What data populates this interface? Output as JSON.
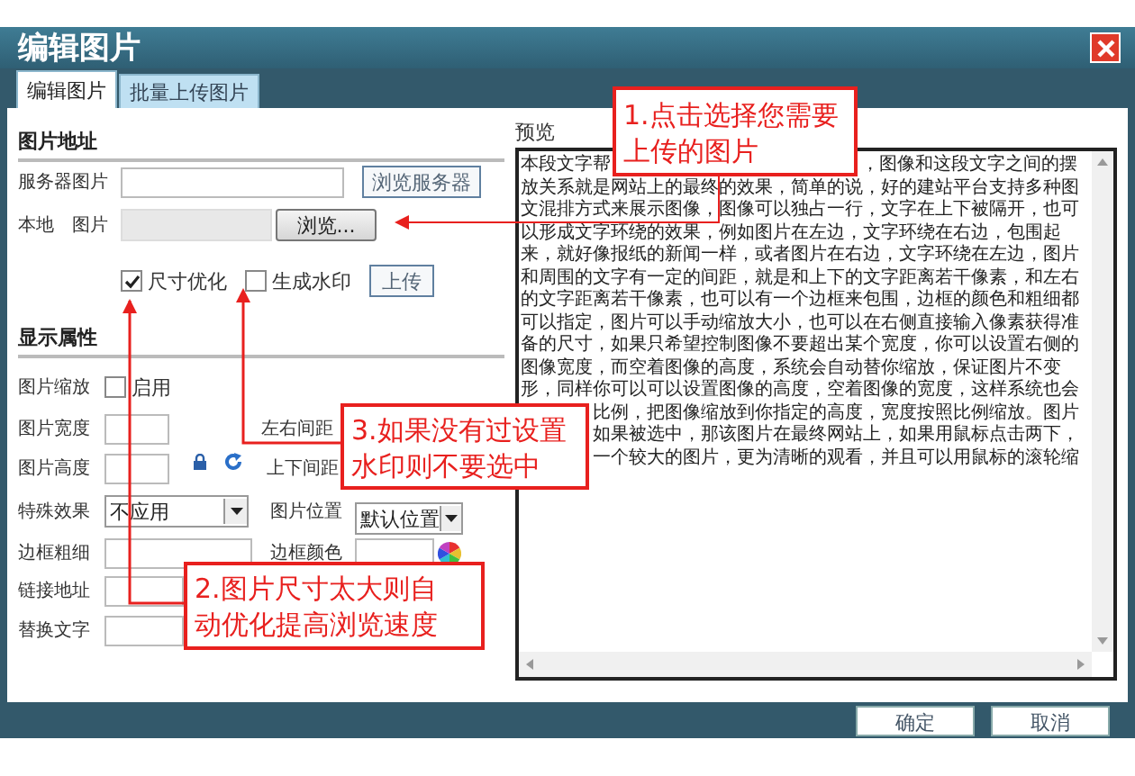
{
  "window": {
    "title": "编辑图片"
  },
  "tabs": [
    {
      "label": "编辑图片",
      "selected": true
    },
    {
      "label": "批量上传图片",
      "selected": false
    }
  ],
  "image_source": {
    "heading": "图片地址",
    "server_label": "服务器图片",
    "browse_server_button": "浏览服务器",
    "local_label": "本地　图片",
    "browse_button": "浏览...",
    "options": [
      {
        "label": "尺寸优化",
        "checked": true
      },
      {
        "label": "生成水印",
        "checked": false
      }
    ],
    "upload_button": "上传"
  },
  "display": {
    "heading": "显示属性",
    "scale_label": "图片缩放",
    "scale_option": {
      "label": "启用",
      "checked": false
    },
    "width_label": "图片宽度",
    "hspace_label": "左右间距",
    "height_label": "图片高度",
    "vspace_label": "上下间距",
    "effect_label": "特殊效果",
    "effect_value": "不应用",
    "position_label": "图片位置",
    "position_value": "默认位置",
    "border_width_label": "边框粗细",
    "border_color_label": "边框颜色",
    "link_label": "链接地址",
    "alt_label": "替换文字"
  },
  "preview": {
    "label": "预览",
    "lines": [
      {
        "parts": [
          "本段文字帮",
          "，图像和这段文字之间的摆"
        ],
        "lead_hidden": false
      },
      {
        "parts": [
          "放关系就是网站上的最终的效果，简单的说，好的建站平台支持多种图"
        ],
        "lead_hidden": false
      },
      {
        "parts": [
          "文混排方式来展示图像，图像可以独占一行，文字在上下被隔开，也可"
        ],
        "lead_hidden": false
      },
      {
        "parts": [
          "以形成文字环绕的效果，例如图片在左边，文字环绕在右边，包围起"
        ],
        "lead_hidden": false
      },
      {
        "parts": [
          "来，就好像报纸的新闻一样，或者图片在右边，文字环绕在左边，图片"
        ],
        "lead_hidden": false
      },
      {
        "parts": [
          "和周围的文字有一定的间距，就是和上下的文字距离若干像素，和左右"
        ],
        "lead_hidden": false
      },
      {
        "parts": [
          "的文字距离若干像素，也可以有一个边框来包围，边框的颜色和粗细都"
        ],
        "lead_hidden": false
      },
      {
        "parts": [
          "可以指定，图片可以手动缩放大小，也可以在右侧直接输入像素获得准"
        ],
        "lead_hidden": false
      },
      {
        "parts": [
          "备的尺寸，如果只希望控制图像不要超出某个宽度，你可以设置右侧的"
        ],
        "lead_hidden": false
      },
      {
        "parts": [
          "图像宽度，而空着图像的高度，系统会自动替你缩放，保证图片不变"
        ],
        "lead_hidden": false
      },
      {
        "parts": [
          "形，同样你可以可以设置图像的高度，空着图像的宽度，这样系统也会"
        ],
        "lead_hidden": false
      },
      {
        "parts": [
          "比例，把图像缩放到你指定的高度，宽度按照比例缩放。图片"
        ],
        "lead_hidden": true
      },
      {
        "parts": [
          "如果被选中，那该图片在最终网站上，如果用鼠标点击两下，"
        ],
        "lead_hidden": true
      },
      {
        "parts": [
          "一个较大的图片，更为清晰的观看，并且可以用鼠标的滚轮缩"
        ],
        "lead_hidden": true
      }
    ]
  },
  "buttons": [
    "确定",
    "取消"
  ],
  "callouts": [
    {
      "lines": [
        "1.点击选择您需要",
        "上传的图片"
      ]
    },
    {
      "lines": [
        "2.图片尺寸太大则自",
        "动优化提高浏览速度"
      ]
    },
    {
      "lines": [
        "3.如果没有过设置",
        "水印则不要选中"
      ]
    }
  ]
}
